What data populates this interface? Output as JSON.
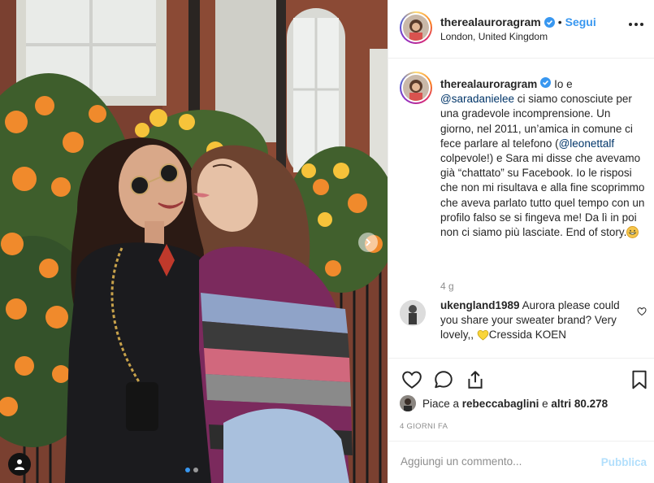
{
  "photo": {
    "alt_icons": [
      "user-tag-icon",
      "chevron-right-icon"
    ],
    "carousel": {
      "count": 2,
      "active_index": 0
    }
  },
  "header": {
    "username": "therealauroragram",
    "separator": "•",
    "follow_label": "Segui",
    "location": "London, United Kingdom"
  },
  "caption": {
    "username": "therealauroragram",
    "text_intro": "Io e",
    "mention_1": "@saradanielee",
    "text_middle": "ci siamo conosciute per una gradevole incomprensione. Un giorno, nel 2011, un’amica in comune ci fece parlare al telefono (",
    "mention_2": "@leonettalf",
    "text_end": "colpevole!) e Sara mi disse che avevamo già “chattato” su Facebook. Io le risposi che non mi risultava e alla fine scoprimmo che aveva parlato tutto quel tempo con un profilo falso se si fingeva me! Da lì in poi non ci siamo più lasciate. End of story.",
    "emoji": "grinning-face",
    "time": "4 g"
  },
  "comment": {
    "username": "ukengland1989",
    "text": "Aurora please could you share your sweater brand? Very lovely,,",
    "emoji": "yellow-heart",
    "text_end": "Cressida KOEN"
  },
  "actions": {
    "likes_prefix": "Piace a",
    "likes_user": "rebeccabaglini",
    "likes_middle": "e",
    "likes_others": "altri 80.278",
    "date": "4 GIORNI FA"
  },
  "add_comment": {
    "placeholder": "Aggiungi un commento...",
    "publish_label": "Pubblica"
  },
  "colors": {
    "accent": "#3897f0",
    "mention": "#003569",
    "muted": "#8e8e8e",
    "publish_disabled": "#b2dffc",
    "verified": "#3897f0"
  }
}
